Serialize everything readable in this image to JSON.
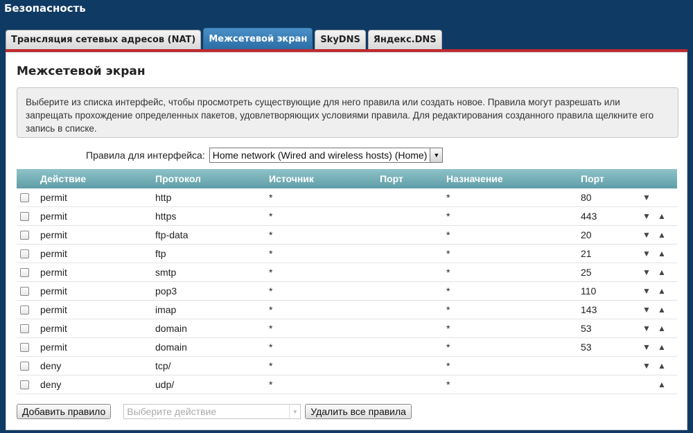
{
  "header": {
    "title": "Безопасность"
  },
  "tabs": [
    {
      "label": "Трансляция сетевых адресов (NAT)",
      "active": false
    },
    {
      "label": "Межсетевой экран",
      "active": true
    },
    {
      "label": "SkyDNS",
      "active": false
    },
    {
      "label": "Яндекс.DNS",
      "active": false
    }
  ],
  "section": {
    "title": "Межсетевой экран",
    "info": "Выберите из списка интерфейс, чтобы просмотреть существующие для него правила или создать новое. Правила могут разрешать или запрещать прохождение определенных пакетов, удовлетворяющих условиями правила. Для редактирования созданного правила щелкните его запись в списке."
  },
  "interface": {
    "label": "Правила для интерфейса:",
    "selected": "Home network (Wired and wireless hosts) (Home)"
  },
  "table": {
    "columns": [
      "Действие",
      "Протокол",
      "Источник",
      "Порт",
      "Назначение",
      "Порт"
    ],
    "rows": [
      {
        "action": "permit",
        "protocol": "http",
        "source": "*",
        "source_port": "",
        "destination": "*",
        "port": "80",
        "down": true,
        "up": false
      },
      {
        "action": "permit",
        "protocol": "https",
        "source": "*",
        "source_port": "",
        "destination": "*",
        "port": "443",
        "down": true,
        "up": true
      },
      {
        "action": "permit",
        "protocol": "ftp-data",
        "source": "*",
        "source_port": "",
        "destination": "*",
        "port": "20",
        "down": true,
        "up": true
      },
      {
        "action": "permit",
        "protocol": "ftp",
        "source": "*",
        "source_port": "",
        "destination": "*",
        "port": "21",
        "down": true,
        "up": true
      },
      {
        "action": "permit",
        "protocol": "smtp",
        "source": "*",
        "source_port": "",
        "destination": "*",
        "port": "25",
        "down": true,
        "up": true
      },
      {
        "action": "permit",
        "protocol": "pop3",
        "source": "*",
        "source_port": "",
        "destination": "*",
        "port": "110",
        "down": true,
        "up": true
      },
      {
        "action": "permit",
        "protocol": "imap",
        "source": "*",
        "source_port": "",
        "destination": "*",
        "port": "143",
        "down": true,
        "up": true
      },
      {
        "action": "permit",
        "protocol": "domain",
        "source": "*",
        "source_port": "",
        "destination": "*",
        "port": "53",
        "down": true,
        "up": true
      },
      {
        "action": "permit",
        "protocol": "domain",
        "source": "*",
        "source_port": "",
        "destination": "*",
        "port": "53",
        "down": true,
        "up": true
      },
      {
        "action": "deny",
        "protocol": "tcp/",
        "source": "*",
        "source_port": "",
        "destination": "*",
        "port": "",
        "down": true,
        "up": true
      },
      {
        "action": "deny",
        "protocol": "udp/",
        "source": "*",
        "source_port": "",
        "destination": "*",
        "port": "",
        "down": false,
        "up": true
      }
    ],
    "arrow_down_glyph": "▼",
    "arrow_up_glyph": "▲"
  },
  "footer": {
    "add_label": "Добавить правило",
    "action_placeholder": "Выберите действие",
    "delete_all_label": "Удалить все правила"
  },
  "colors": {
    "background": "#0f3a63",
    "active_tab": "#2c6ea6",
    "accent_line": "#c0282d",
    "table_header": "#5f9ea7"
  },
  "icons": [
    "checkbox-icon",
    "arrow-down-icon",
    "arrow-up-icon",
    "dropdown-arrow-icon"
  ]
}
